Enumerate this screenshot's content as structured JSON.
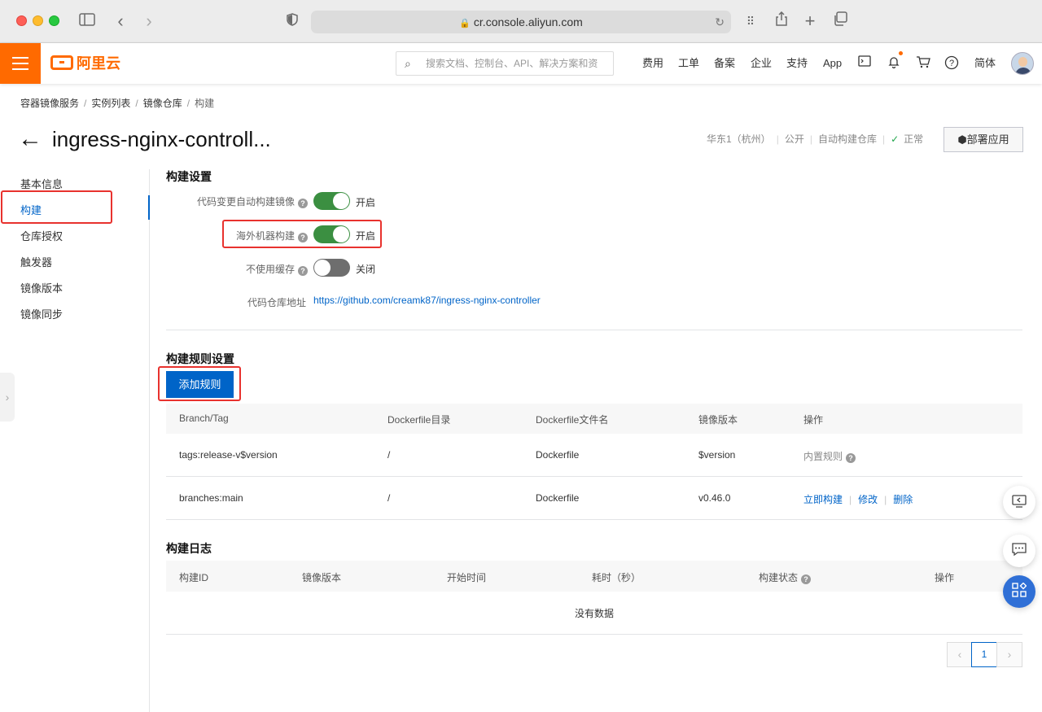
{
  "browser": {
    "url": "cr.console.aliyun.com"
  },
  "topbar": {
    "logo_text": "阿里云",
    "search_placeholder": "搜索文档、控制台、API、解决方案和资",
    "nav": [
      "费用",
      "工单",
      "备案",
      "企业",
      "支持",
      "App"
    ],
    "lang": "简体"
  },
  "breadcrumb": [
    "容器镜像服务",
    "实例列表",
    "镜像仓库",
    "构建"
  ],
  "header": {
    "title": "ingress-nginx-controll...",
    "region": "华东1（杭州）",
    "visibility": "公开",
    "repo_type": "自动构建仓库",
    "status": "正常",
    "deploy_label": "部署应用"
  },
  "sidenav": {
    "items": [
      "基本信息",
      "构建",
      "仓库授权",
      "触发器",
      "镜像版本",
      "镜像同步"
    ]
  },
  "build_settings": {
    "title": "构建设置",
    "auto_build": {
      "label": "代码变更自动构建镜像",
      "state": "开启",
      "on": true
    },
    "overseas_build": {
      "label": "海外机器构建",
      "state": "开启",
      "on": true
    },
    "no_cache": {
      "label": "不使用缓存",
      "state": "关闭",
      "on": false
    },
    "repo_label": "代码仓库地址",
    "repo_url": "https://github.com/creamk87/ingress-nginx-controller"
  },
  "build_rules": {
    "title": "构建规则设置",
    "add_label": "添加规则",
    "columns": [
      "Branch/Tag",
      "Dockerfile目录",
      "Dockerfile文件名",
      "镜像版本",
      "操作"
    ],
    "rows": [
      {
        "ref": "tags:release-v$version",
        "dir": "/",
        "file": "Dockerfile",
        "version": "$version",
        "builtin": "内置规则"
      },
      {
        "ref": "branches:main",
        "dir": "/",
        "file": "Dockerfile",
        "version": "v0.46.0",
        "action_build": "立即构建",
        "action_edit": "修改",
        "action_delete": "删除"
      }
    ]
  },
  "build_log": {
    "title": "构建日志",
    "columns": [
      "构建ID",
      "镜像版本",
      "开始时间",
      "耗时（秒）",
      "构建状态",
      "操作"
    ],
    "empty": "没有数据"
  },
  "pagination": {
    "current": "1"
  },
  "colors": {
    "brand": "#ff6a00",
    "primary": "#0064c8",
    "highlight": "#e8322e",
    "switch_on": "#3b8f41"
  }
}
